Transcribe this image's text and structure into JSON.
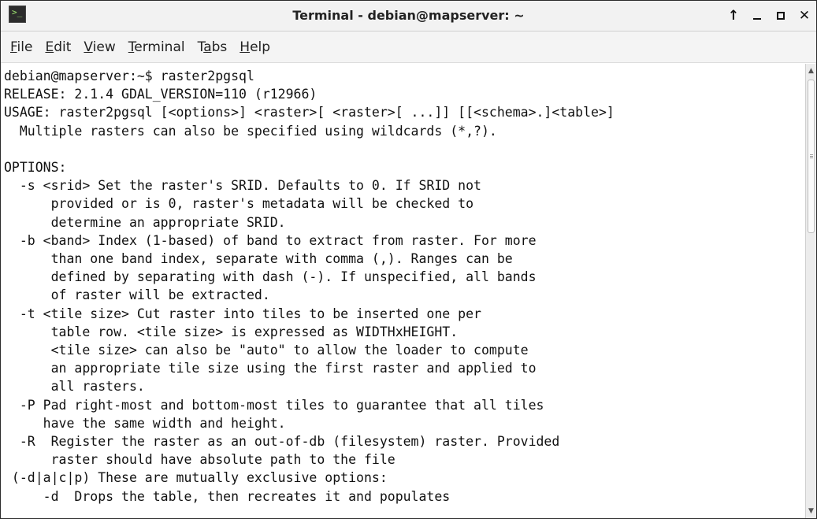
{
  "window": {
    "title": "Terminal - debian@mapserver: ~",
    "icon": "terminal-icon",
    "controls": [
      "up-arrow-icon",
      "minimize-icon",
      "maximize-icon",
      "close-icon"
    ]
  },
  "menubar": {
    "items": [
      {
        "mnemonic": "F",
        "rest": "ile"
      },
      {
        "mnemonic": "E",
        "rest": "dit"
      },
      {
        "mnemonic": "V",
        "rest": "iew"
      },
      {
        "mnemonic": "T",
        "rest": "erminal"
      },
      {
        "prefix": "T",
        "mnemonic": "a",
        "rest": "bs"
      },
      {
        "mnemonic": "H",
        "rest": "elp"
      }
    ]
  },
  "terminal": {
    "lines": [
      "debian@mapserver:~$ raster2pgsql",
      "RELEASE: 2.1.4 GDAL_VERSION=110 (r12966)",
      "USAGE: raster2pgsql [<options>] <raster>[ <raster>[ ...]] [[<schema>.]<table>]",
      "  Multiple rasters can also be specified using wildcards (*,?).",
      "",
      "OPTIONS:",
      "  -s <srid> Set the raster's SRID. Defaults to 0. If SRID not",
      "      provided or is 0, raster's metadata will be checked to",
      "      determine an appropriate SRID.",
      "  -b <band> Index (1-based) of band to extract from raster. For more",
      "      than one band index, separate with comma (,). Ranges can be",
      "      defined by separating with dash (-). If unspecified, all bands",
      "      of raster will be extracted.",
      "  -t <tile size> Cut raster into tiles to be inserted one per",
      "      table row. <tile size> is expressed as WIDTHxHEIGHT.",
      "      <tile size> can also be \"auto\" to allow the loader to compute",
      "      an appropriate tile size using the first raster and applied to",
      "      all rasters.",
      "  -P Pad right-most and bottom-most tiles to guarantee that all tiles",
      "     have the same width and height.",
      "  -R  Register the raster as an out-of-db (filesystem) raster. Provided",
      "      raster should have absolute path to the file",
      " (-d|a|c|p) These are mutually exclusive options:",
      "     -d  Drops the table, then recreates it and populates"
    ]
  }
}
